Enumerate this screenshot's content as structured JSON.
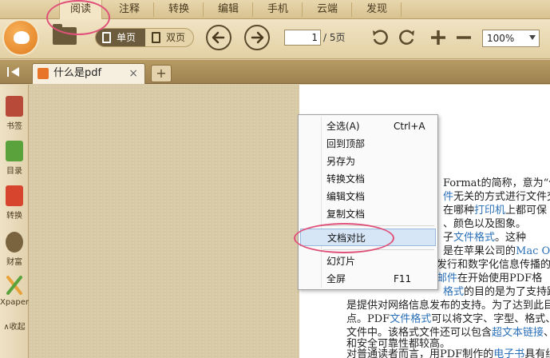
{
  "tabs": [
    "阅读",
    "注释",
    "转换",
    "编辑",
    "手机",
    "云端",
    "发现"
  ],
  "toolbar": {
    "view_single": "单页",
    "view_double": "双页",
    "page_current": "1",
    "page_total": "/ 5页",
    "zoom": "100%"
  },
  "document_tab": {
    "title": "什么是pdf",
    "close": "×",
    "add": "+"
  },
  "sidebar": {
    "items": [
      {
        "label": "书签",
        "icon": "bookmark-icon",
        "color": "#b84a3a"
      },
      {
        "label": "目录",
        "icon": "toc-icon",
        "color": "#5aa33c"
      },
      {
        "label": "转换",
        "icon": "convert-icon",
        "color": "#d8452e"
      },
      {
        "label": "财富",
        "icon": "money-icon",
        "color": "#7a6440"
      },
      {
        "label": "Xpaper",
        "icon": "xpaper-icon",
        "color": "#e9a13a"
      }
    ],
    "collapse": "∧收起"
  },
  "context_menu": {
    "items": [
      {
        "label": "全选(A)",
        "shortcut": "Ctrl+A"
      },
      {
        "label": "回到顶部",
        "shortcut": ""
      },
      {
        "label": "另存为",
        "shortcut": ""
      },
      {
        "label": "转换文档",
        "shortcut": ""
      },
      {
        "label": "编辑文档",
        "shortcut": ""
      },
      {
        "label": "复制文档",
        "shortcut": ""
      },
      {
        "label": "文档对比",
        "shortcut": ""
      },
      {
        "label": "幻灯片",
        "shortcut": ""
      },
      {
        "label": "全屏",
        "shortcut": "F11"
      }
    ]
  },
  "document_text": {
    "l1a": "Format的简称，意为“便",
    "l2a": "件",
    "l2b": "无关的方式进行文件交",
    "l3a": "在哪种",
    "l3b": "打印机",
    "l3c": "上都可保",
    "l4a": "、颜色以及图象。",
    "l5a": "子",
    "l5b": "文件格式",
    "l5c": "。这种",
    "l6a": "是在苹果公司的",
    "l6b": "Mac O",
    "l7a": "发行和数字化信息传播的",
    "l8a": "邮件",
    "l8b": "在开始使用PDF格",
    "l9a": "格式",
    "l9b": "的目的是为了支持跨",
    "l10a": "是提供对网络信息发布的支持。为了达到此目的",
    "l11a": "点。PDF",
    "l11b": "文件格式",
    "l11c": "可以将文字、字型、格式、颜",
    "l12a": "文件中。该格式文件还可以包含",
    "l12b": "超文本链接",
    "l12c": "、声",
    "l13a": "和安全可靠性都较高。",
    "l14a": "对普通读者而言，用PDF制作的",
    "l14b": "电子书",
    "l14c": "具有纸版"
  },
  "colors": {
    "link": "#2a6fb8",
    "annotation": "#e0517a",
    "accent": "#e07a1c"
  }
}
